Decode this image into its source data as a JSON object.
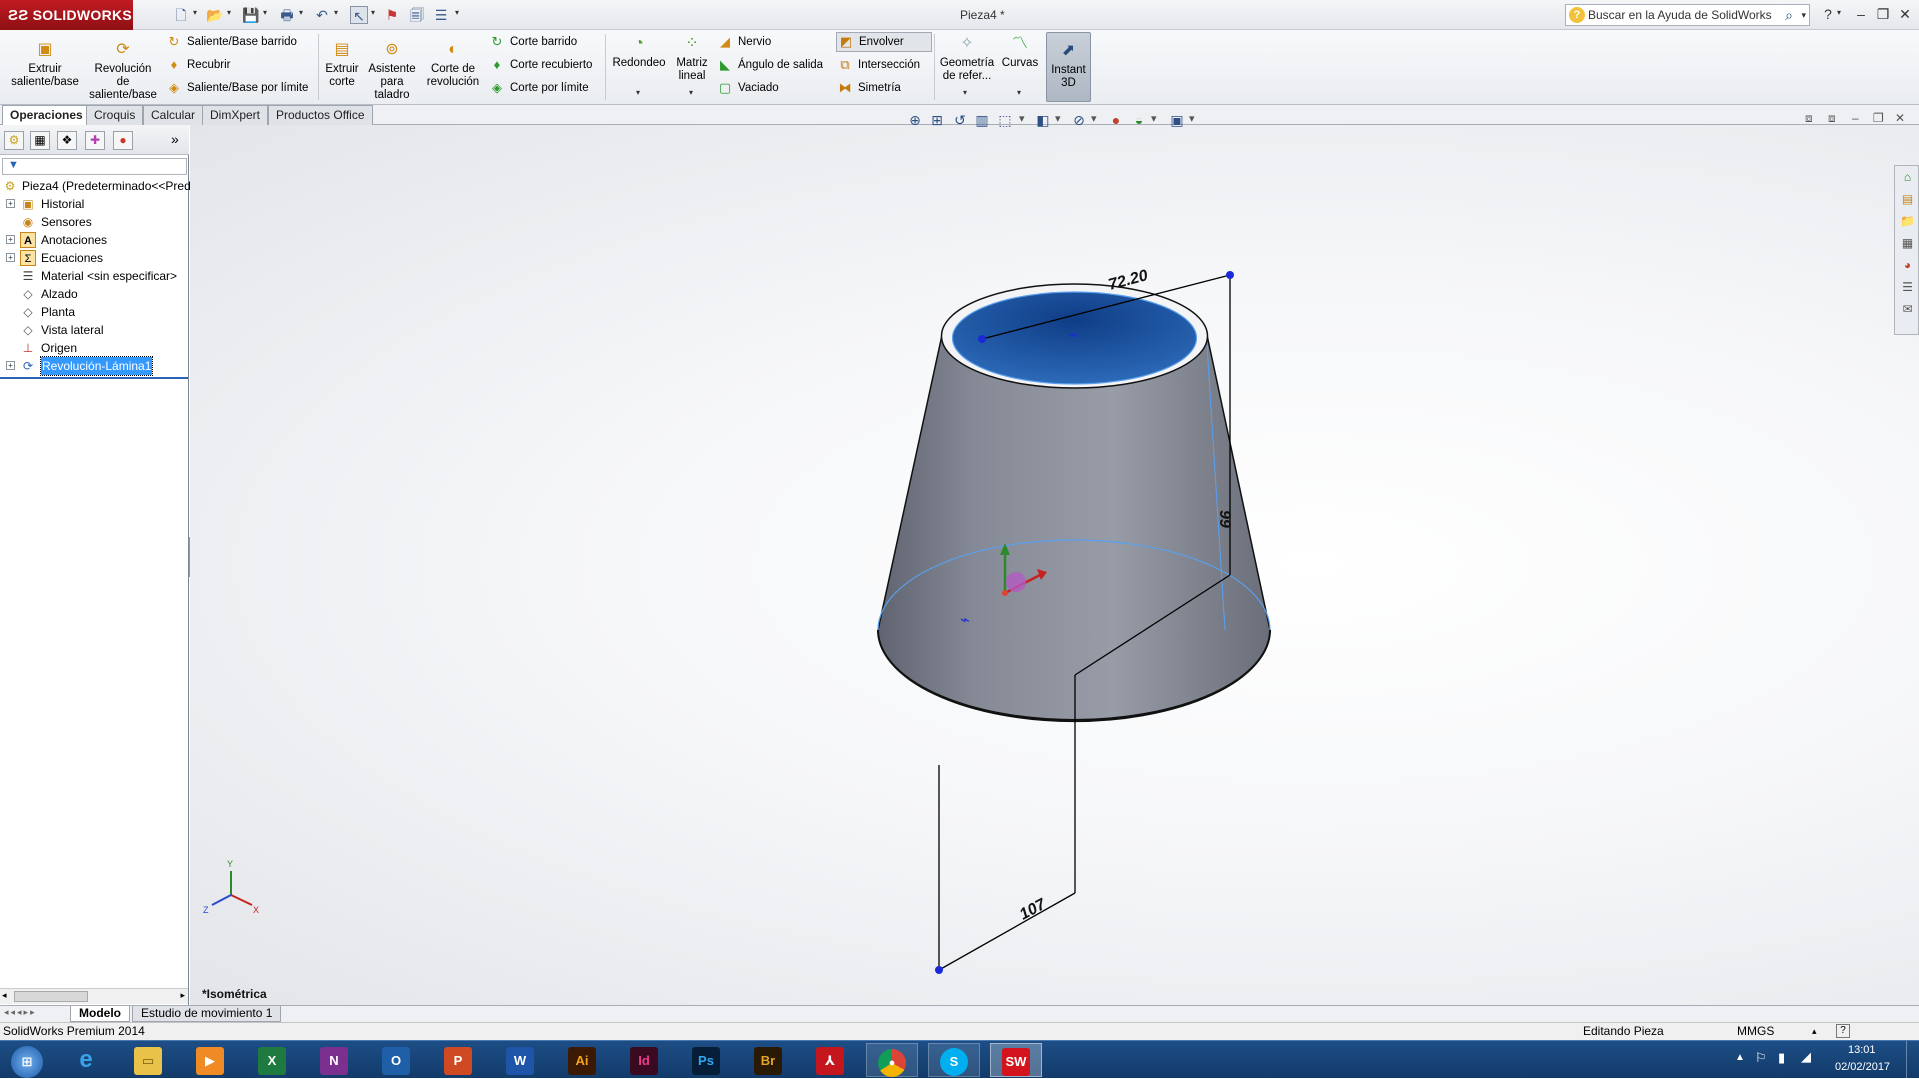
{
  "app": {
    "logo": "SOLIDWORKS",
    "document_title": "Pieza4 *",
    "help_search_placeholder": "Buscar en la Ayuda de SolidWorks"
  },
  "ribbon": {
    "extrude_boss": "Extruir saliente/base",
    "revolve_boss": "Revolución de saliente/base",
    "swept_boss": "Saliente/Base barrido",
    "loft": "Recubrir",
    "boundary_boss": "Saliente/Base por límite",
    "extrude_cut": "Extruir corte",
    "hole_wizard": "Asistente para taladro",
    "revolve_cut": "Corte de revolución",
    "swept_cut": "Corte barrido",
    "lofted_cut": "Corte recubierto",
    "boundary_cut": "Corte por límite",
    "fillet": "Redondeo",
    "linear_pattern": "Matriz lineal",
    "rib": "Nervio",
    "draft": "Ángulo de salida",
    "shell": "Vaciado",
    "wrap": "Envolver",
    "intersect": "Intersección",
    "mirror": "Simetría",
    "ref_geometry": "Geometría de refer...",
    "curves": "Curvas",
    "instant3d": "Instant 3D"
  },
  "tabs": [
    "Operaciones",
    "Croquis",
    "Calcular",
    "DimXpert",
    "Productos Office"
  ],
  "tree": {
    "root": "Pieza4  (Predeterminado<<Pred",
    "items": [
      "Historial",
      "Sensores",
      "Anotaciones",
      "Ecuaciones",
      "Material <sin especificar>",
      "Alzado",
      "Planta",
      "Vista lateral",
      "Origen",
      "Revolución-Lámina1"
    ]
  },
  "viewport": {
    "view_label": "*Isométrica",
    "dim_top": "72.20",
    "dim_height": "99",
    "dim_bottom": "107"
  },
  "bottom_tabs": [
    "Modelo",
    "Estudio de movimiento 1"
  ],
  "status": {
    "product": "SolidWorks Premium 2014",
    "mode": "Editando Pieza",
    "units": "MMGS"
  },
  "taskbar": {
    "time": "13:01",
    "date": "02/02/2017"
  },
  "colors": {
    "accent": "#c21b22",
    "part_body": "#8c919c",
    "part_inner": "#2a5ea8",
    "selection": "#3399ff"
  }
}
